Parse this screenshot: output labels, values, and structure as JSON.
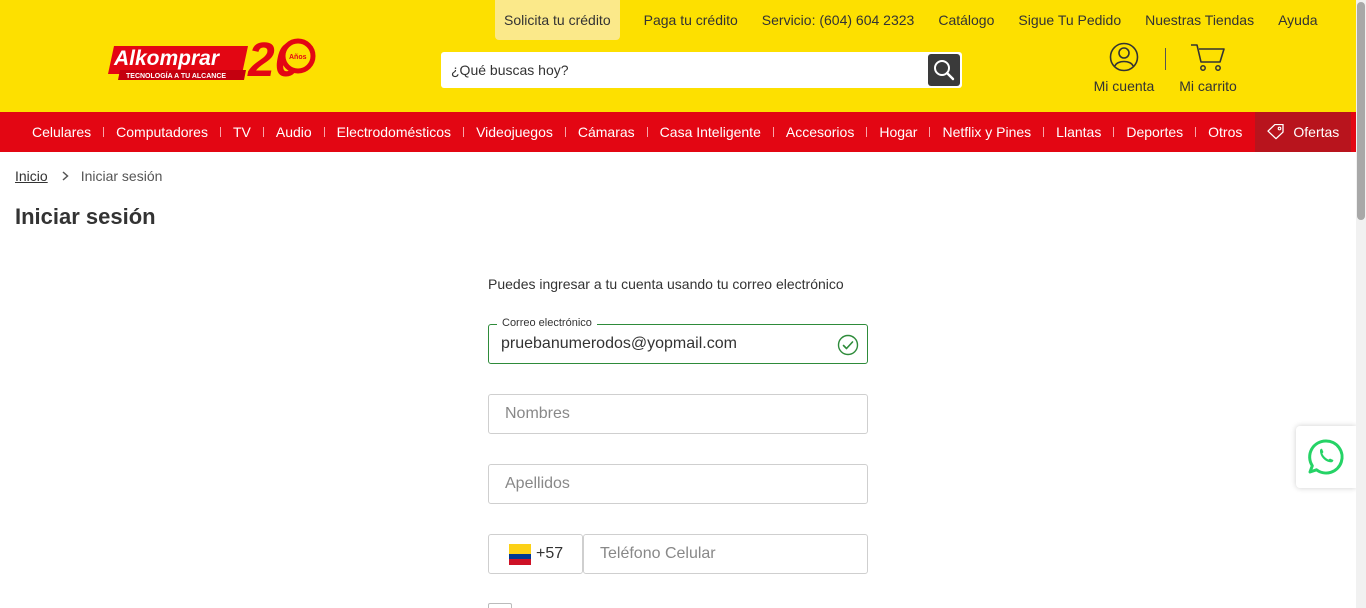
{
  "header": {
    "logo": {
      "brand": "Alkomprar",
      "tagline": "TECNOLOGÍA A TU ALCANCE",
      "anniversary": "20",
      "anniversary_unit": "Años"
    },
    "top_links": [
      {
        "label": "Solicita tu crédito"
      },
      {
        "label": "Paga tu crédito"
      },
      {
        "label": "Servicio: (604) 604 2323"
      },
      {
        "label": "Catálogo"
      },
      {
        "label": "Sigue Tu Pedido"
      },
      {
        "label": "Nuestras Tiendas"
      },
      {
        "label": "Ayuda"
      }
    ],
    "search": {
      "placeholder": "¿Qué buscas hoy?",
      "icon": "search-icon"
    },
    "account_label": "Mi cuenta",
    "cart_label": "Mi carrito"
  },
  "nav": {
    "items": [
      {
        "label": "Celulares"
      },
      {
        "label": "Computadores"
      },
      {
        "label": "TV"
      },
      {
        "label": "Audio"
      },
      {
        "label": "Electrodomésticos"
      },
      {
        "label": "Videojuegos"
      },
      {
        "label": "Cámaras"
      },
      {
        "label": "Casa Inteligente"
      },
      {
        "label": "Accesorios"
      },
      {
        "label": "Hogar"
      },
      {
        "label": "Netflix y Pines"
      },
      {
        "label": "Llantas"
      },
      {
        "label": "Deportes"
      },
      {
        "label": "Otros"
      }
    ],
    "offers_label": "Ofertas"
  },
  "breadcrumb": {
    "home": "Inicio",
    "current": "Iniciar sesión"
  },
  "page_title": "Iniciar sesión",
  "form": {
    "intro": "Puedes ingresar a tu cuenta usando tu correo electrónico",
    "email": {
      "label": "Correo electrónico",
      "value": "pruebanumerodos@yopmail.com",
      "status": "valid"
    },
    "first_name": {
      "placeholder": "Nombres"
    },
    "last_name": {
      "placeholder": "Apellidos"
    },
    "phone": {
      "country_code": "+57",
      "country": "Colombia",
      "placeholder": "Teléfono Celular"
    }
  },
  "colors": {
    "header_bg": "#fde000",
    "nav_bg": "#e30613",
    "offers_bg": "#b8141d",
    "valid_green": "#2e8b3a",
    "whatsapp_green": "#25d366"
  }
}
